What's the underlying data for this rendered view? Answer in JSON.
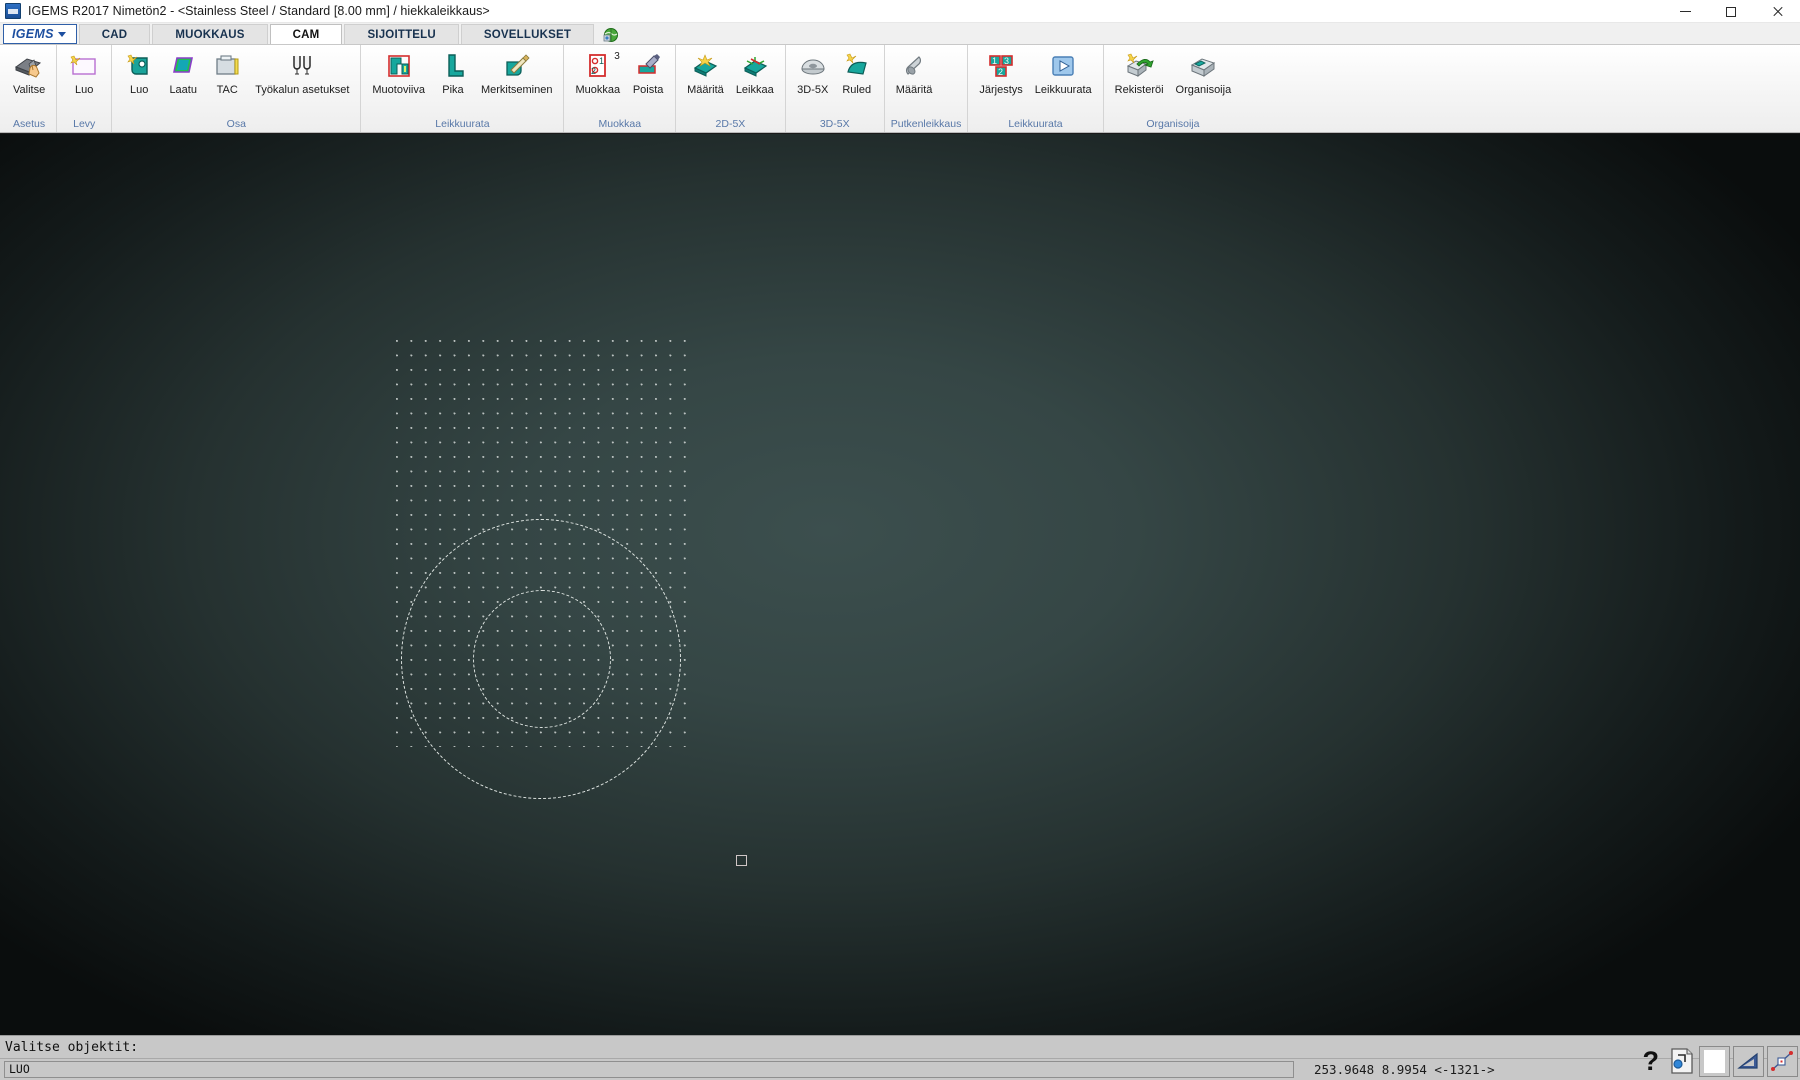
{
  "window": {
    "app_icon": "igems-app-icon",
    "title": "IGEMS R2017  Nimetön2 - <Stainless Steel / Standard [8.00 mm] / hiekkaleikkaus>",
    "controls": {
      "minimize": "minimize-icon",
      "maximize": "restore-icon",
      "close": "close-icon"
    }
  },
  "tabs": {
    "brand": "IGEMS",
    "items": [
      {
        "label": "CAD",
        "active": false
      },
      {
        "label": "MUOKKAUS",
        "active": false
      },
      {
        "label": "CAM",
        "active": true
      },
      {
        "label": "SIJOITTELU",
        "active": false
      },
      {
        "label": "SOVELLUKSET",
        "active": false
      }
    ],
    "extra_icon": "globe-icon"
  },
  "ribbon": {
    "groups": [
      {
        "label": "Asetus",
        "buttons": [
          {
            "label": "Valitse",
            "icon": "select-hand-icon"
          }
        ]
      },
      {
        "label": "Levy",
        "buttons": [
          {
            "label": "Luo",
            "icon": "new-plate-icon"
          }
        ]
      },
      {
        "label": "Osa",
        "buttons": [
          {
            "label": "Luo",
            "icon": "new-part-icon"
          },
          {
            "label": "Laatu",
            "icon": "quality-icon"
          },
          {
            "label": "TAC",
            "icon": "tac-icon"
          },
          {
            "label": "Työkalun asetukset",
            "icon": "tool-settings-icon"
          }
        ]
      },
      {
        "label": "Leikkuurata",
        "buttons": [
          {
            "label": "Muotoviiva",
            "icon": "contour-line-icon"
          },
          {
            "label": "Pika",
            "icon": "quick-path-icon"
          },
          {
            "label": "Merkitseminen",
            "icon": "marking-icon"
          }
        ]
      },
      {
        "label": "Muokkaa",
        "buttons": [
          {
            "label": "Muokkaa",
            "icon": "edit-order-icon",
            "badge": "3"
          },
          {
            "label": "Poista",
            "icon": "delete-icon"
          }
        ]
      },
      {
        "label": "2D-5X",
        "buttons": [
          {
            "label": "Määritä",
            "icon": "define-2d5x-icon"
          },
          {
            "label": "Leikkaa",
            "icon": "cut-2d5x-icon"
          }
        ]
      },
      {
        "label": "3D-5X",
        "buttons": [
          {
            "label": "3D-5X",
            "icon": "dome-3d5x-icon"
          },
          {
            "label": "Ruled",
            "icon": "ruled-surface-icon"
          }
        ]
      },
      {
        "label": "Putkenleikkaus",
        "buttons": [
          {
            "label": "Määritä",
            "icon": "tube-cut-icon"
          }
        ]
      },
      {
        "label": "Leikkuurata",
        "buttons": [
          {
            "label": "Järjestys",
            "icon": "sequence-order-icon"
          },
          {
            "label": "Leikkuurata",
            "icon": "play-simulate-icon"
          }
        ]
      },
      {
        "label": "Organisoija",
        "buttons": [
          {
            "label": "Rekisteröi",
            "icon": "register-box-icon"
          },
          {
            "label": "Organisoija",
            "icon": "organizer-box-icon"
          }
        ]
      }
    ]
  },
  "canvas": {
    "description": "dark teal gradient CAD viewport with dotted snap grid and two dashed circles",
    "cursor": "square-pick-cursor"
  },
  "status": {
    "prompt": "Valitse objektit:",
    "command_value": "LUO",
    "coordinates": "253.9648  8.9954  <-1321->",
    "help_icon": "question-help-icon",
    "tools": [
      {
        "icon": "snap-object-icon",
        "name": "osnap-toggle"
      },
      {
        "icon": "blank-swatch-icon",
        "name": "color-swatch"
      },
      {
        "icon": "triangle-ruler-icon",
        "name": "ortho-toggle"
      },
      {
        "icon": "line-node-icon",
        "name": "node-snap-toggle"
      }
    ]
  }
}
